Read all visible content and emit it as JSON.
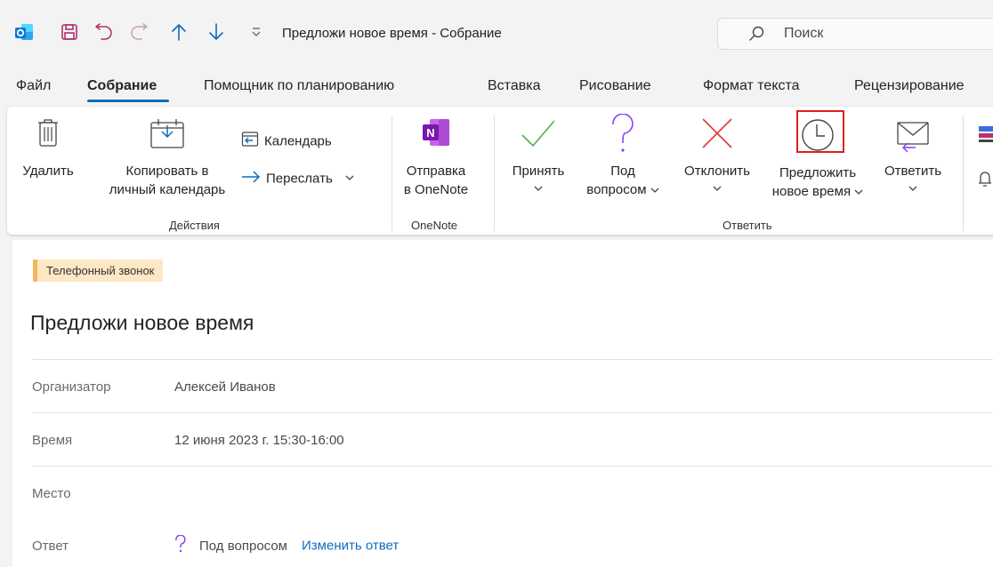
{
  "window": {
    "title": "Предложи новое время - Собрание"
  },
  "search": {
    "label": "Поиск"
  },
  "tabs": [
    {
      "label": "Файл"
    },
    {
      "label": "Собрание"
    },
    {
      "label": "Помощник по планированию"
    },
    {
      "label": "Вставка"
    },
    {
      "label": "Рисование"
    },
    {
      "label": "Формат текста"
    },
    {
      "label": "Рецензирование"
    }
  ],
  "ribbon": {
    "delete": "Удалить",
    "copy_line1": "Копировать в",
    "copy_line2": "личный календарь",
    "calendar": "Календарь",
    "forward": "Переслать",
    "onenote_line1": "Отправка",
    "onenote_line2": "в OneNote",
    "accept": "Принять",
    "tentative_line1": "Под",
    "tentative_line2": "вопросом",
    "decline": "Отклонить",
    "propose_line1": "Предложить",
    "propose_line2": "новое время",
    "reply": "Ответить",
    "group_actions": "Действия",
    "group_onenote": "OneNote",
    "group_respond": "Ответить"
  },
  "colors": {
    "accent": "#0f6cbd",
    "accept": "#4caf50",
    "tentative": "#8a3ffc",
    "decline": "#e53935",
    "highlight": "#e0201b"
  },
  "meeting": {
    "category": "Телефонный звонок",
    "subject": "Предложи новое время",
    "organizer_label": "Организатор",
    "organizer": "Алексей Иванов",
    "time_label": "Время",
    "time": "12 июня 2023 г. 15:30-16:00",
    "location_label": "Место",
    "location": "",
    "response_label": "Ответ",
    "response": "Под вопросом",
    "change_response": "Изменить ответ"
  }
}
